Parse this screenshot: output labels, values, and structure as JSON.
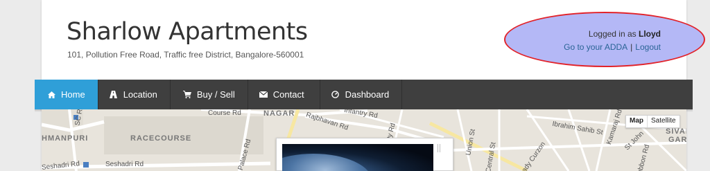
{
  "header": {
    "title": "Sharlow Apartments",
    "address": "101, Pollution Free Road, Traffic free District, Bangalore-560001"
  },
  "login": {
    "prefix": "Logged in as",
    "username": "Lloyd",
    "adda_link": "Go to your ADDA",
    "separator": "|",
    "logout_link": "Logout",
    "highlight_fill": "#b4b8f6",
    "highlight_stroke": "#e2232a"
  },
  "nav": {
    "active_color": "#2f9fd8",
    "bar_color": "#3f3f3f",
    "items": [
      {
        "label": "Home",
        "icon": "home-icon"
      },
      {
        "label": "Location",
        "icon": "road-icon"
      },
      {
        "label": "Buy / Sell",
        "icon": "cart-icon"
      },
      {
        "label": "Contact",
        "icon": "envelope-icon"
      },
      {
        "label": "Dashboard",
        "icon": "dashboard-icon"
      }
    ]
  },
  "map": {
    "labels": [
      "SC R",
      "HMANPURI",
      "RACECOURSE",
      "Seshadri Rd",
      "Seshadri Rd",
      "Course Rd",
      "NAGAR",
      "Infantry Rd",
      "Rajbhavan Rd",
      "Palace Rd",
      "Union St",
      "Central St",
      "Lady Curzon",
      "Kamaraj Rd",
      "Ibrahim Sahib St",
      "St John",
      "SIVAN",
      "GAR",
      "Dy Rd",
      "Cubbon Rd"
    ],
    "map_button": "Map",
    "satellite_button": "Satellite"
  }
}
